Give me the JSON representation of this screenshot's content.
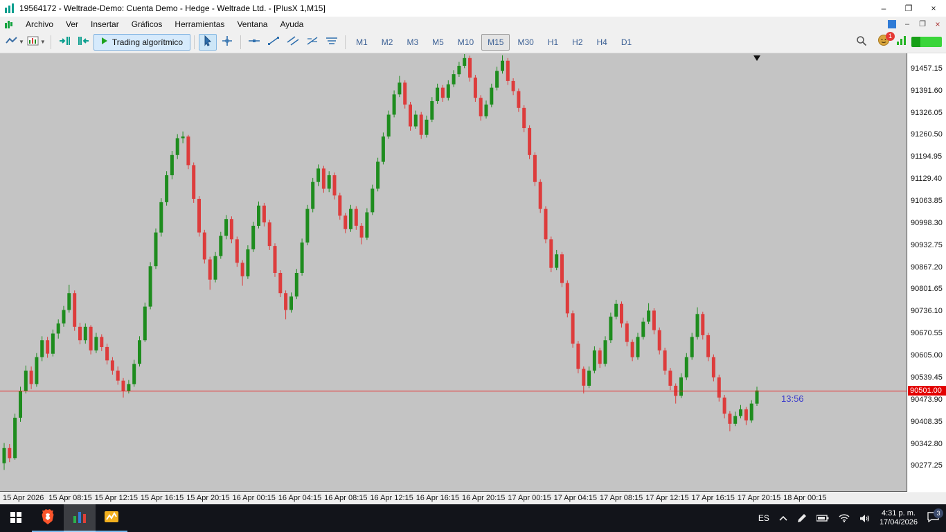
{
  "window": {
    "title": "19564172 - Weltrade-Demo: Cuenta Demo - Hedge - Weltrade Ltd. - [PlusX 1,M15]",
    "controls": {
      "minimize": "–",
      "maximize": "❐",
      "close": "×"
    }
  },
  "menubar": {
    "items": [
      "Archivo",
      "Ver",
      "Insertar",
      "Gráficos",
      "Herramientas",
      "Ventana",
      "Ayuda"
    ],
    "child_controls": {
      "minimize": "–",
      "restore": "❐",
      "close": "×"
    }
  },
  "toolbar": {
    "algo_trading_label": "Trading algorítmico",
    "timeframes": [
      "M1",
      "M2",
      "M3",
      "M5",
      "M10",
      "M15",
      "M30",
      "H1",
      "H2",
      "H4",
      "D1"
    ],
    "active_timeframe": "M15",
    "notification_count": "1"
  },
  "chart_data": {
    "type": "candlestick",
    "symbol": "PlusX 1",
    "timeframe": "M15",
    "background": "#c4c4c4",
    "up_color": "#1e8c1e",
    "down_color": "#dd3c3c",
    "grid": false,
    "current_price": 90501.0,
    "current_price_label": "90501.00",
    "candle_countdown": "13:56",
    "price_max": 91502,
    "price_min": 90200,
    "price_axis_labels": [
      "91457.15",
      "91391.60",
      "91326.05",
      "91260.50",
      "91194.95",
      "91129.40",
      "91063.85",
      "90998.30",
      "90932.75",
      "90867.20",
      "90801.65",
      "90736.10",
      "90670.55",
      "90605.00",
      "90539.45",
      "90473.90",
      "90408.35",
      "90342.80",
      "90277.25"
    ],
    "time_axis_labels": [
      "15 Apr 2026",
      "15 Apr 08:15",
      "15 Apr 12:15",
      "15 Apr 16:15",
      "15 Apr 20:15",
      "16 Apr 00:15",
      "16 Apr 04:15",
      "16 Apr 08:15",
      "16 Apr 12:15",
      "16 Apr 16:15",
      "16 Apr 20:15",
      "17 Apr 00:15",
      "17 Apr 04:15",
      "17 Apr 08:15",
      "17 Apr 12:15",
      "17 Apr 16:15",
      "17 Apr 20:15",
      "18 Apr 00:15"
    ],
    "candles": [
      [
        90285,
        90345,
        90265,
        90330
      ],
      [
        90330,
        90342,
        90288,
        90300
      ],
      [
        90300,
        90432,
        90295,
        90420
      ],
      [
        90420,
        90512,
        90408,
        90500
      ],
      [
        90500,
        90575,
        90492,
        90560
      ],
      [
        90560,
        90572,
        90505,
        90520
      ],
      [
        90520,
        90612,
        90512,
        90600
      ],
      [
        90600,
        90662,
        90588,
        90650
      ],
      [
        90650,
        90660,
        90598,
        90610
      ],
      [
        90610,
        90682,
        90602,
        90670
      ],
      [
        90670,
        90712,
        90655,
        90700
      ],
      [
        90700,
        90752,
        90690,
        90740
      ],
      [
        90740,
        90815,
        90732,
        90790
      ],
      [
        90790,
        90798,
        90678,
        90690
      ],
      [
        90690,
        90702,
        90638,
        90650
      ],
      [
        90650,
        90700,
        90640,
        90690
      ],
      [
        90690,
        90695,
        90608,
        90620
      ],
      [
        90620,
        90672,
        90612,
        90660
      ],
      [
        90660,
        90668,
        90618,
        90630
      ],
      [
        90630,
        90640,
        90578,
        90590
      ],
      [
        90590,
        90600,
        90548,
        90560
      ],
      [
        90560,
        90572,
        90518,
        90530
      ],
      [
        90530,
        90538,
        90480,
        90500
      ],
      [
        90500,
        90532,
        90492,
        90520
      ],
      [
        90520,
        90592,
        90512,
        90580
      ],
      [
        90580,
        90662,
        90572,
        90650
      ],
      [
        90650,
        90762,
        90645,
        90750
      ],
      [
        90750,
        90882,
        90742,
        90870
      ],
      [
        90870,
        90982,
        90862,
        90970
      ],
      [
        90970,
        91072,
        90958,
        91060
      ],
      [
        91060,
        91152,
        91050,
        91140
      ],
      [
        91140,
        91212,
        91128,
        91200
      ],
      [
        91200,
        91262,
        91188,
        91250
      ],
      [
        91250,
        91270,
        91235,
        91255
      ],
      [
        91255,
        91260,
        91158,
        91170
      ],
      [
        91170,
        91178,
        91058,
        91070
      ],
      [
        91070,
        91078,
        90958,
        90970
      ],
      [
        90970,
        90978,
        90878,
        90890
      ],
      [
        90890,
        90898,
        90800,
        90830
      ],
      [
        90830,
        90912,
        90822,
        90900
      ],
      [
        90900,
        90972,
        90892,
        90960
      ],
      [
        90960,
        91022,
        90950,
        91010
      ],
      [
        91010,
        91018,
        90938,
        90950
      ],
      [
        90950,
        90958,
        90868,
        90880
      ],
      [
        90880,
        90888,
        90812,
        90840
      ],
      [
        90840,
        90932,
        90832,
        90920
      ],
      [
        90920,
        91002,
        90912,
        90990
      ],
      [
        90990,
        91062,
        90982,
        91050
      ],
      [
        91050,
        91058,
        90988,
        91000
      ],
      [
        91000,
        91008,
        90918,
        90930
      ],
      [
        90930,
        90938,
        90838,
        90850
      ],
      [
        90850,
        90858,
        90778,
        90790
      ],
      [
        90790,
        90798,
        90712,
        90740
      ],
      [
        90740,
        90792,
        90732,
        90780
      ],
      [
        90780,
        90862,
        90772,
        90850
      ],
      [
        90850,
        90952,
        90842,
        90940
      ],
      [
        90940,
        91052,
        90932,
        91040
      ],
      [
        91040,
        91132,
        91030,
        91120
      ],
      [
        91120,
        91172,
        91108,
        91160
      ],
      [
        91160,
        91168,
        91088,
        91100
      ],
      [
        91100,
        91152,
        91090,
        91140
      ],
      [
        91140,
        91148,
        91068,
        91080
      ],
      [
        91080,
        91088,
        91008,
        91020
      ],
      [
        91020,
        91028,
        90968,
        90980
      ],
      [
        90980,
        91052,
        90972,
        91040
      ],
      [
        91040,
        91048,
        90978,
        90990
      ],
      [
        90990,
        90998,
        90935,
        90955
      ],
      [
        90955,
        91042,
        90948,
        91030
      ],
      [
        91030,
        91112,
        91022,
        91100
      ],
      [
        91100,
        91192,
        91092,
        91180
      ],
      [
        91180,
        91267,
        91172,
        91255
      ],
      [
        91255,
        91332,
        91248,
        91320
      ],
      [
        91320,
        91392,
        91312,
        91380
      ],
      [
        91380,
        91435,
        91372,
        91415
      ],
      [
        91415,
        91422,
        91338,
        91350
      ],
      [
        91350,
        91358,
        91272,
        91285
      ],
      [
        91285,
        91332,
        91278,
        91320
      ],
      [
        91320,
        91328,
        91248,
        91260
      ],
      [
        91260,
        91317,
        91252,
        91305
      ],
      [
        91305,
        91372,
        91298,
        91360
      ],
      [
        91360,
        91412,
        91352,
        91400
      ],
      [
        91400,
        91408,
        91358,
        91370
      ],
      [
        91370,
        91422,
        91362,
        91410
      ],
      [
        91410,
        91452,
        91402,
        91440
      ],
      [
        91440,
        91477,
        91432,
        91465
      ],
      [
        91465,
        91500,
        91458,
        91488
      ],
      [
        91488,
        91495,
        91418,
        91430
      ],
      [
        91430,
        91438,
        91358,
        91370
      ],
      [
        91370,
        91378,
        91302,
        91315
      ],
      [
        91315,
        91362,
        91308,
        91350
      ],
      [
        91350,
        91412,
        91342,
        91400
      ],
      [
        91400,
        91462,
        91392,
        91450
      ],
      [
        91450,
        91496,
        91442,
        91480
      ],
      [
        91480,
        91488,
        91408,
        91420
      ],
      [
        91420,
        91428,
        91378,
        91390
      ],
      [
        91390,
        91398,
        91328,
        91340
      ],
      [
        91340,
        91348,
        91268,
        91280
      ],
      [
        91280,
        91288,
        91188,
        91200
      ],
      [
        91200,
        91208,
        91108,
        91120
      ],
      [
        91120,
        91128,
        91028,
        91040
      ],
      [
        91040,
        91048,
        90938,
        90950
      ],
      [
        90950,
        90958,
        90852,
        90865
      ],
      [
        90865,
        90918,
        90858,
        90905
      ],
      [
        90905,
        90912,
        90808,
        90820
      ],
      [
        90820,
        90828,
        90718,
        90730
      ],
      [
        90730,
        90738,
        90628,
        90640
      ],
      [
        90640,
        90648,
        90552,
        90565
      ],
      [
        90565,
        90572,
        90492,
        90515
      ],
      [
        90515,
        90572,
        90508,
        90560
      ],
      [
        90560,
        90632,
        90552,
        90620
      ],
      [
        90620,
        90628,
        90568,
        90580
      ],
      [
        90580,
        90662,
        90572,
        90650
      ],
      [
        90650,
        90732,
        90642,
        90720
      ],
      [
        90720,
        90770,
        90712,
        90758
      ],
      [
        90758,
        90765,
        90688,
        90700
      ],
      [
        90700,
        90708,
        90632,
        90645
      ],
      [
        90645,
        90652,
        90588,
        90600
      ],
      [
        90600,
        90672,
        90592,
        90660
      ],
      [
        90660,
        90717,
        90652,
        90705
      ],
      [
        90705,
        90760,
        90698,
        90738
      ],
      [
        90738,
        90745,
        90668,
        90680
      ],
      [
        90680,
        90688,
        90608,
        90620
      ],
      [
        90620,
        90628,
        90548,
        90560
      ],
      [
        90560,
        90568,
        90502,
        90515
      ],
      [
        90515,
        90522,
        90462,
        90485
      ],
      [
        90485,
        90552,
        90478,
        90540
      ],
      [
        90540,
        90612,
        90532,
        90600
      ],
      [
        90600,
        90672,
        90592,
        90660
      ],
      [
        90660,
        90748,
        90652,
        90728
      ],
      [
        90728,
        90735,
        90652,
        90665
      ],
      [
        90665,
        90672,
        90588,
        90600
      ],
      [
        90600,
        90608,
        90528,
        90540
      ],
      [
        90540,
        90548,
        90468,
        90480
      ],
      [
        90480,
        90488,
        90418,
        90432
      ],
      [
        90432,
        90440,
        90380,
        90402
      ],
      [
        90402,
        90438,
        90395,
        90425
      ],
      [
        90425,
        90458,
        90418,
        90445
      ],
      [
        90445,
        90452,
        90398,
        90412
      ],
      [
        90412,
        90472,
        90405,
        90462
      ],
      [
        90462,
        90512,
        90455,
        90501
      ]
    ]
  },
  "taskbar": {
    "language": "ES",
    "time": "4:31 p. m.",
    "date": "17/04/2026",
    "action_center_badge": "3"
  }
}
